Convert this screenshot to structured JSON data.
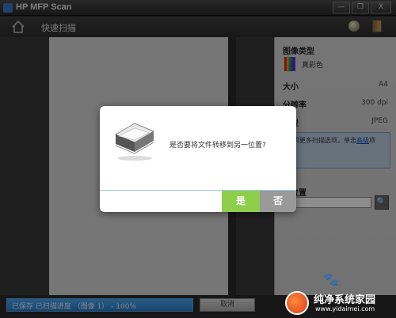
{
  "window": {
    "title": "HP MFP Scan"
  },
  "title_buttons": {
    "minimize": "—",
    "maximize": "❐",
    "close": "X"
  },
  "toolbar": {
    "title": "快速扫描"
  },
  "panel": {
    "image_type_title": "图像类型",
    "color_label": "真彩色",
    "size_label": "大小",
    "size_value": "A4",
    "resolution_label": "分辨率",
    "resolution_value": "300 dpi",
    "filetype_label": "类型",
    "filetype_value": "JPEG",
    "info_text": "访问更多扫描选项，单击",
    "info_link": "高级",
    "info_tail": "项",
    "destination_label": "到位置",
    "destination_button": "🔍"
  },
  "statusbar": {
    "progress_text": "已保存 已扫描进度 （图像 1） - 100%",
    "progress_value": 1.0,
    "cancel_label": "取消"
  },
  "dialog": {
    "message": "是否要将文件转移到另一位置?",
    "yes_label": "是",
    "no_label": "否"
  },
  "watermark": {
    "brand": "纯净系统家园",
    "url": "www.yidaimei.com"
  },
  "colors": {
    "accent_yes": "#8fce4a",
    "accent_no": "#9a9a9a",
    "progress": "#2a7cc8"
  }
}
